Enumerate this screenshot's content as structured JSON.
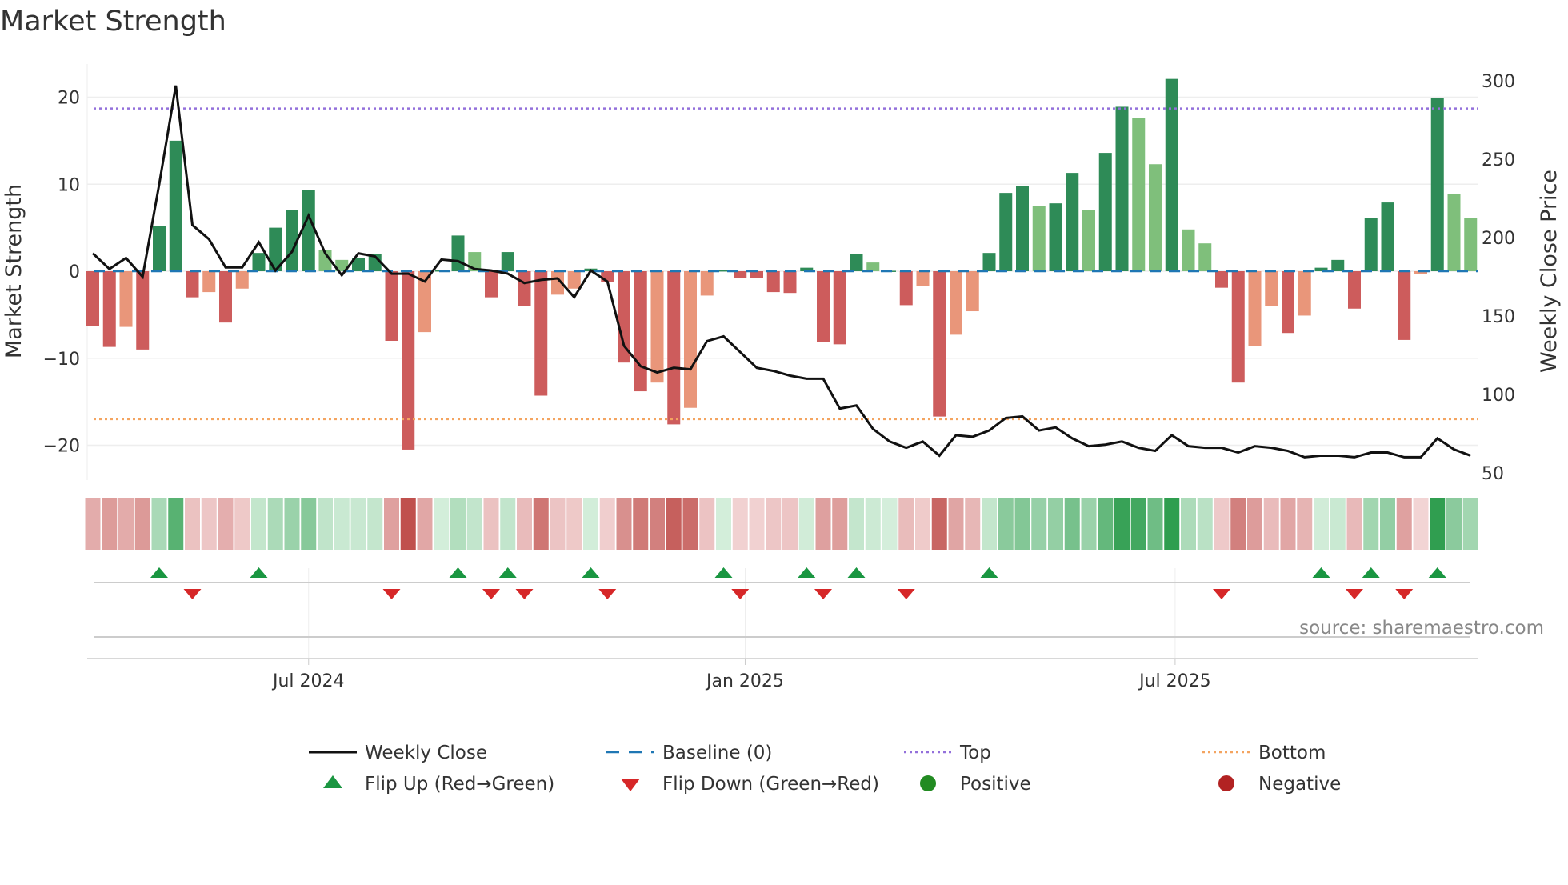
{
  "chart_data": {
    "type": "bar",
    "title": "Market Strength",
    "ylabel": "Market Strength",
    "y2label": "Weekly Close Price",
    "ylim": [
      -24,
      24
    ],
    "y2lim": [
      50,
      300
    ],
    "yticks": [
      "20",
      "10",
      "0",
      "−10",
      "−20"
    ],
    "ytick_values": [
      20,
      10,
      0,
      -10,
      -20
    ],
    "y2ticks": [
      "300",
      "250",
      "200",
      "150",
      "100",
      "50"
    ],
    "y2tick_values": [
      300,
      250,
      200,
      150,
      100,
      50
    ],
    "xticks": [
      {
        "label": "Jul 2024",
        "week": 13
      },
      {
        "label": "Jan 2025",
        "week": 39.3
      },
      {
        "label": "Jul 2025",
        "week": 65.2
      }
    ],
    "top_level": 18.7,
    "bottom_level": -17,
    "strength": [
      -6.3,
      -8.7,
      -6.4,
      -9,
      5.2,
      15,
      -3,
      -2.4,
      -5.9,
      -2,
      2.1,
      5,
      7,
      9.3,
      2.4,
      1.3,
      1.5,
      2,
      -8,
      -20.5,
      -7,
      0.1,
      4.1,
      2.2,
      -3,
      2.2,
      -4,
      -14.3,
      -2.7,
      -2,
      0.3,
      -1.2,
      -10.5,
      -13.8,
      -12.8,
      -17.6,
      -15.7,
      -2.8,
      0.1,
      -0.8,
      -0.8,
      -2.4,
      -2.5,
      0.4,
      -8.1,
      -8.4,
      2,
      1,
      0.05,
      -3.9,
      -1.7,
      -16.7,
      -7.3,
      -4.6,
      2.1,
      9,
      9.8,
      7.5,
      7.8,
      11.3,
      7,
      13.6,
      18.9,
      17.6,
      12.3,
      22.1,
      4.8,
      3.2,
      -1.9,
      -12.8,
      -8.6,
      -4,
      -7.1,
      -5.1,
      0.4,
      1.3,
      -4.3,
      6.1,
      7.9,
      -7.9,
      -0.3,
      19.9,
      8.9,
      6.1
    ],
    "weakening": [
      0,
      0,
      1,
      0,
      0,
      0,
      0,
      1,
      0,
      1,
      0,
      0,
      0,
      0,
      1,
      1,
      0,
      0,
      0,
      0,
      1,
      0,
      0,
      1,
      0,
      0,
      0,
      0,
      1,
      1,
      0,
      0,
      0,
      0,
      1,
      0,
      1,
      1,
      0,
      0,
      0,
      0,
      0,
      0,
      0,
      0,
      0,
      1,
      0,
      0,
      1,
      0,
      1,
      1,
      0,
      0,
      0,
      1,
      0,
      0,
      1,
      0,
      0,
      1,
      1,
      0,
      1,
      1,
      0,
      0,
      1,
      1,
      0,
      1,
      0,
      0,
      0,
      0,
      0,
      0,
      1,
      0,
      1,
      1
    ],
    "weekly_close": [
      190,
      180,
      187,
      175,
      234,
      297,
      208,
      199,
      181,
      181,
      197,
      179,
      191,
      214,
      190,
      176,
      190,
      188,
      177,
      177,
      172,
      186,
      185,
      180,
      179,
      177,
      171,
      173,
      174,
      162,
      179,
      172,
      131,
      118,
      114,
      117,
      116,
      134,
      137,
      127,
      117,
      115,
      112,
      110,
      110,
      91,
      93,
      78,
      70,
      66,
      70,
      61,
      74,
      73,
      77,
      85,
      86,
      77,
      79,
      72,
      67,
      68,
      70,
      66,
      64,
      74,
      67,
      66,
      66,
      63,
      67,
      66,
      64,
      60,
      61,
      61,
      60,
      63,
      63,
      60,
      60,
      72,
      65,
      61
    ],
    "flip_up_weeks": [
      4,
      10,
      22,
      25,
      30,
      38,
      43,
      46,
      54,
      74,
      77,
      81
    ],
    "flip_down_weeks": [
      6,
      18,
      24,
      26,
      31,
      39,
      44,
      49,
      68,
      76,
      79
    ],
    "legend": [
      "Weekly Close",
      "Baseline (0)",
      "Top",
      "Bottom",
      "Flip Up (Red→Green)",
      "Flip Down (Green→Red)",
      "Positive",
      "Negative"
    ],
    "legend_placement": "bottom",
    "source": "source: sharemaestro.com"
  },
  "colors": {
    "strong_pos": "#2e8b57",
    "weak_pos": "#7fbf7b",
    "strong_neg": "#cd5c5c",
    "weak_neg": "#e9967a",
    "close": "#111111",
    "baseline": "#1f77b4",
    "top": "#9370db",
    "bottom": "#f4a460",
    "flip_up": "#1a9641",
    "flip_down": "#d62728",
    "positive": "#228b22",
    "negative": "#b22222"
  }
}
